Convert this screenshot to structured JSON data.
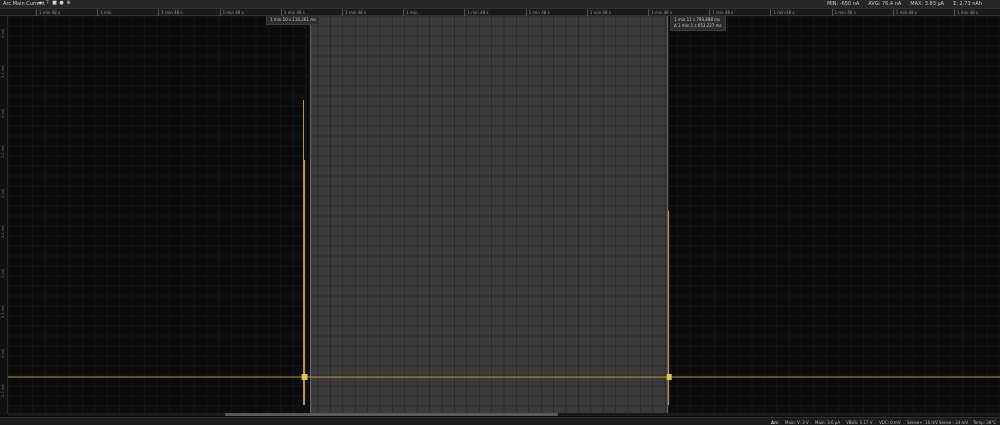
{
  "header": {
    "title": "Arc Main Current",
    "tools": [
      "◂▸",
      "?",
      "■",
      "●",
      "⊕"
    ],
    "stats": [
      {
        "label": "MIN:",
        "value": "-650 nA"
      },
      {
        "label": "AVG:",
        "value": "76.4 nA"
      },
      {
        "label": "MAX:",
        "value": "3.83 µA"
      },
      {
        "label": "Σ:",
        "value": "2.73 nAh"
      }
    ]
  },
  "ruler_ticks": [
    {
      "label": "1 min 48 s"
    },
    {
      "label": "1 min"
    },
    {
      "label": "1 min 48 s"
    },
    {
      "label": "1 min 48 s"
    },
    {
      "label": "1 min 48 s"
    },
    {
      "label": "1 min 48 s"
    },
    {
      "label": "1 min"
    },
    {
      "label": "1 min 48 s"
    },
    {
      "label": "1 min 48 s"
    },
    {
      "label": "1 min 48 s"
    },
    {
      "label": "1 min 48 s"
    },
    {
      "label": "1 min 48 s"
    },
    {
      "label": "1 min 48 s"
    },
    {
      "label": "1 min 48 s"
    },
    {
      "label": "1 min 48 s"
    },
    {
      "label": "1 min 48 s"
    }
  ],
  "y_labels": [
    "4 mA",
    "3.5 mA",
    "3 mA",
    "2.5 mA",
    "2 mA",
    "1.5 mA",
    "1 mA",
    "0.5 mA",
    "0 mA",
    "-0.5 mA"
  ],
  "cursor_left": {
    "label": "1 min 10 s 116.261 ms"
  },
  "cursor_right": {
    "time": "1 min 11 s 799.488 ms",
    "delta": "Δ 1 min 1 s 653.227 ms"
  },
  "selection": {
    "start_fraction": 0.305,
    "end_fraction": 0.665
  },
  "status": {
    "source": "Arc",
    "items": [
      "Main: V: 3 V",
      "Main: 3.6 µA",
      "VBUS: 5.17 V",
      "VDC: 0 mV",
      "Sense+: 16 mV",
      "Sense-: 34 mV",
      "Temp: 38°C"
    ]
  },
  "colors": {
    "signal": "#e8c13a",
    "selection": "#3b3b3b",
    "background": "#0b0b0b"
  },
  "chart_data": {
    "type": "line",
    "title": "Arc Main Current",
    "baseline_value": 0,
    "spikes": [
      {
        "position_fraction": 0.298,
        "peak_value": 3.83
      },
      {
        "position_fraction": 0.299,
        "peak_value": 3.0
      },
      {
        "position_fraction": 0.666,
        "peak_value": 2.3
      }
    ],
    "grid": true
  }
}
